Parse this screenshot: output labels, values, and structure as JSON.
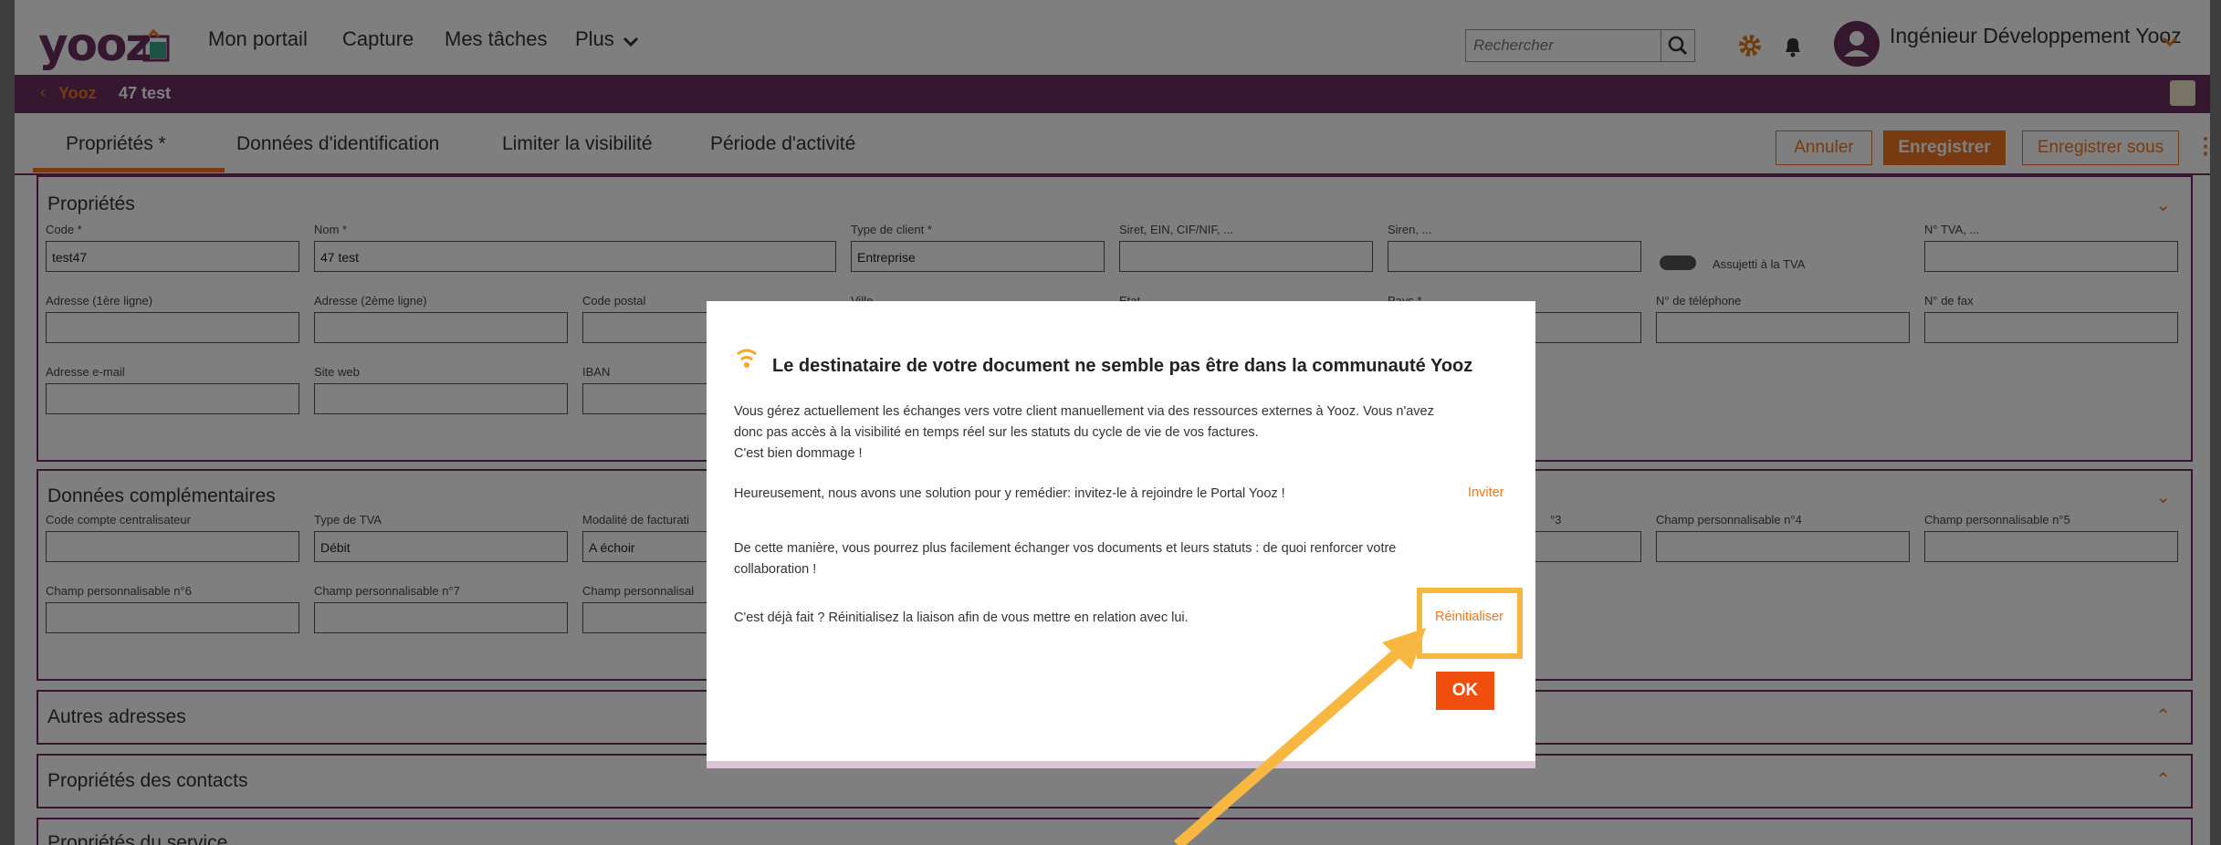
{
  "header": {
    "logo": "yooz",
    "nav": [
      "Mon portail",
      "Capture",
      "Mes tâches",
      "Plus"
    ],
    "search_placeholder": "Rechercher",
    "user_name": "Ingénieur Développement Yooz"
  },
  "breadcrumb": {
    "back": "Yooz",
    "current": "47 test"
  },
  "tabs": [
    "Propriétés *",
    "Données d'identification",
    "Limiter la visibilité",
    "Période d'activité"
  ],
  "actions": {
    "cancel": "Annuler",
    "save": "Enregistrer",
    "save_as": "Enregistrer sous"
  },
  "properties": {
    "title": "Propriétés",
    "code_label": "Code *",
    "code_value": "test47",
    "name_label": "Nom *",
    "name_value": "47 test",
    "client_type_label": "Type de client *",
    "client_type_value": "Entreprise",
    "siret_label": "Siret, EIN, CIF/NIF, ...",
    "siren_label": "Siren, ...",
    "vat_toggle_label": "Assujetti à la TVA",
    "vat_label": "N° TVA, ...",
    "addr1_label": "Adresse (1ère ligne)",
    "addr2_label": "Adresse (2ème ligne)",
    "postal_label": "Code postal",
    "city_label": "Ville",
    "state_label": "Etat",
    "country_label": "Pays *",
    "phone_label": "N° de téléphone",
    "fax_label": "N° de fax",
    "email_label": "Adresse e-mail",
    "web_label": "Site web",
    "iban_label": "IBAN"
  },
  "complementary": {
    "title": "Données complémentaires",
    "account_label": "Code compte centralisateur",
    "vat_type_label": "Type de TVA",
    "vat_type_value": "Débit",
    "billing_label": "Modalité de facturati",
    "billing_value": "A échoir",
    "c3_label": "°3",
    "c4_label": "Champ personnalisable n°4",
    "c5_label": "Champ personnalisable n°5",
    "c6_label": "Champ personnalisable n°6",
    "c7_label": "Champ personnalisable n°7",
    "c8_label": "Champ personnalisal"
  },
  "sections": {
    "other_addresses": "Autres adresses",
    "contacts": "Propriétés des contacts",
    "cut": "Propriétés du service"
  },
  "modal": {
    "title": "Le destinataire de votre document ne semble pas être dans la communauté Yooz",
    "p1_line1": "Vous gérez actuellement les échanges vers votre client manuellement via des ressources externes à Yooz. Vous n'avez",
    "p1_line2": "donc pas accès à la visibilité en temps réel sur les statuts du cycle de vie de vos factures.",
    "p1_line3": "C'est bien dommage !",
    "p2": "Heureusement, nous avons une solution pour y remédier: invitez-le à rejoindre le Portal Yooz !",
    "invite": "Inviter",
    "p3_line1": "De cette manière, vous pourrez plus facilement échanger vos documents et leurs statuts : de quoi renforcer votre",
    "p3_line2": "collaboration !",
    "p4": "C'est déjà fait ? Réinitialisez la liaison afin de vous mettre en relation avec lui.",
    "reset": "Réinitialiser",
    "ok": "OK"
  },
  "colors": {
    "brand": "#6b2e5f",
    "accent": "#f07722",
    "highlight": "#f7b740"
  }
}
